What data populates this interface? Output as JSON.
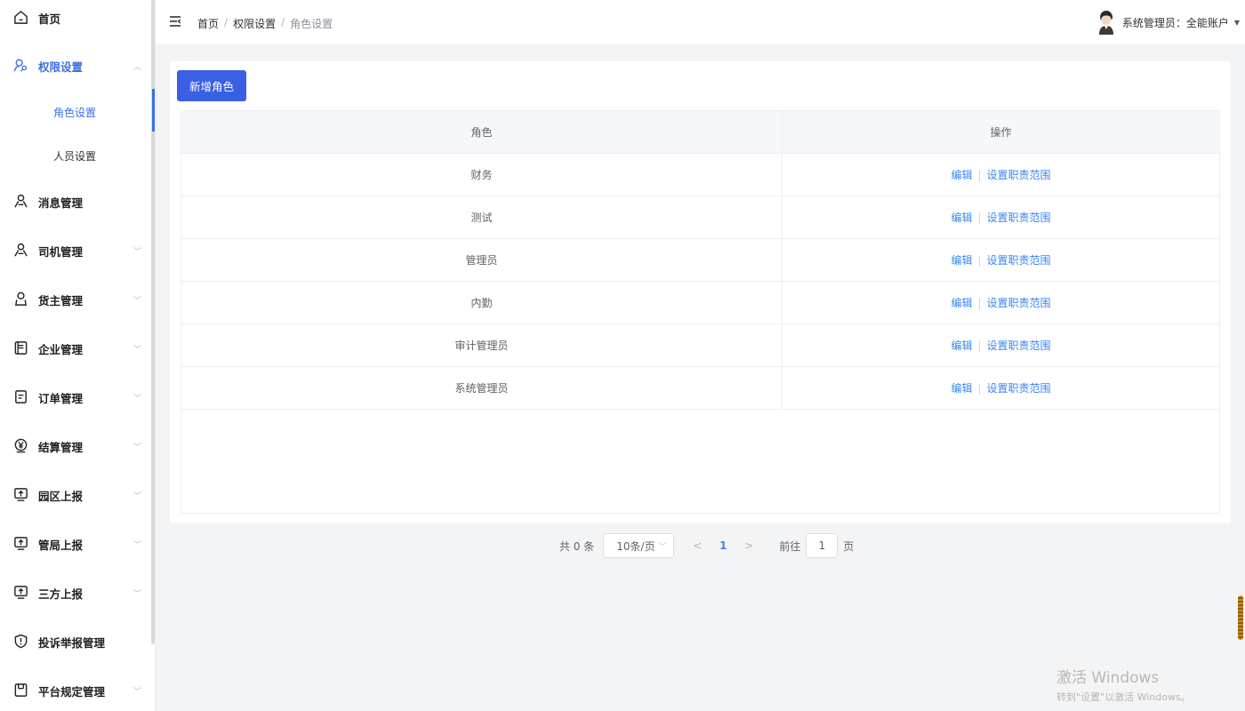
{
  "sidebar": {
    "items": [
      {
        "label": "首页",
        "icon": "home-icon",
        "arrow": ""
      },
      {
        "label": "权限设置",
        "icon": "user-key-icon",
        "arrow": "up",
        "active": true
      },
      {
        "label": "消息管理",
        "icon": "users-icon",
        "arrow": ""
      },
      {
        "label": "司机管理",
        "icon": "users-icon",
        "arrow": "down"
      },
      {
        "label": "货主管理",
        "icon": "user-icon",
        "arrow": "down"
      },
      {
        "label": "企业管理",
        "icon": "building-icon",
        "arrow": "down"
      },
      {
        "label": "订单管理",
        "icon": "document-icon",
        "arrow": "down"
      },
      {
        "label": "结算管理",
        "icon": "yen-icon",
        "arrow": "down"
      },
      {
        "label": "园区上报",
        "icon": "upload-icon",
        "arrow": "down"
      },
      {
        "label": "管局上报",
        "icon": "upload-icon",
        "arrow": "down"
      },
      {
        "label": "三方上报",
        "icon": "upload-icon",
        "arrow": "down"
      },
      {
        "label": "投诉举报管理",
        "icon": "shield-icon",
        "arrow": ""
      },
      {
        "label": "平台规定管理",
        "icon": "rules-icon",
        "arrow": "down"
      }
    ],
    "sub_items": [
      {
        "label": "角色设置",
        "active": true
      },
      {
        "label": "人员设置",
        "active": false
      }
    ]
  },
  "header": {
    "breadcrumb": [
      "首页",
      "权限设置",
      "角色设置"
    ],
    "breadcrumb_sep": "/",
    "user_name": "系统管理员：全能账户"
  },
  "main": {
    "add_button": "新增角色",
    "table": {
      "columns": [
        "角色",
        "操作"
      ],
      "rows": [
        "财务",
        "测试",
        "管理员",
        "内勤",
        "审计管理员",
        "系统管理员"
      ],
      "edit_label": "编辑",
      "scope_label": "设置职责范围",
      "op_sep": "|"
    }
  },
  "pagination": {
    "total": "共 0 条",
    "page_size": "10条/页",
    "prev": "<",
    "next": ">",
    "current_page": "1",
    "goto_label": "前往",
    "goto_value": "1",
    "page_label": "页"
  },
  "watermark": {
    "line1": "激活 Windows",
    "line2": "转到\"设置\"以激活 Windows。"
  },
  "colors": {
    "accent": "#3a5fe5",
    "link": "#3a86f5"
  }
}
